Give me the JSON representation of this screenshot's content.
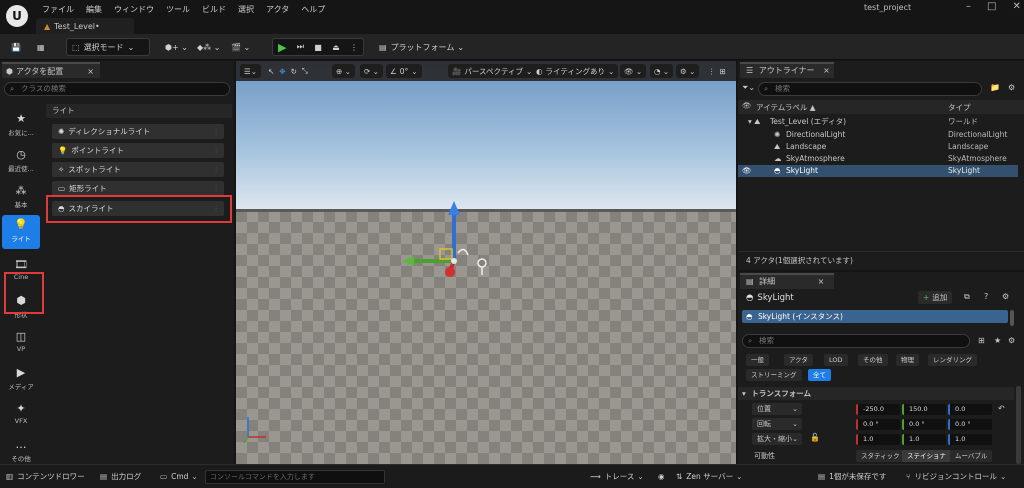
{
  "window": {
    "menu": [
      "ファイル",
      "編集",
      "ウィンドウ",
      "ツール",
      "ビルド",
      "選択",
      "アクタ",
      "ヘルプ"
    ],
    "level_tab": "Test_Level•",
    "project_name": "test_project"
  },
  "toolbar": {
    "select_mode": "選択モード",
    "platforms": "プラットフォーム"
  },
  "place_actors": {
    "tab_label": "アクタを配置",
    "search_placeholder": "クラスの検索",
    "section": "ライト",
    "categories": [
      "お気に...",
      "最近使...",
      "基本",
      "ライト",
      "Cine",
      "形状",
      "VP",
      "メディア",
      "VFX",
      "その他"
    ],
    "items": [
      "ディレクショナルライト",
      "ポイントライト",
      "スポットライト",
      "矩形ライト",
      "スカイライト"
    ]
  },
  "viewport": {
    "perspective": "パースペクティブ",
    "lighting": "ライティングあり",
    "snap_angle": "0°"
  },
  "outliner": {
    "tab_label": "アウトライナー",
    "search_placeholder": "検索",
    "col_label": "アイテムラベル ▲",
    "col_type": "タイプ",
    "rows": [
      {
        "name": "Test_Level (エディタ)",
        "type": "ワールド"
      },
      {
        "name": "DirectionalLight",
        "type": "DirectionalLight"
      },
      {
        "name": "Landscape",
        "type": "Landscape"
      },
      {
        "name": "SkyAtmosphere",
        "type": "SkyAtmosphere"
      },
      {
        "name": "SkyLight",
        "type": "SkyLight"
      }
    ],
    "footer": "4 アクタ(1個選択されています)"
  },
  "details": {
    "tab_label": "詳細",
    "actor_name": "SkyLight",
    "add_label": "追加",
    "component": "SkyLight (インスタンス)",
    "search_placeholder": "検索",
    "filters": [
      "一般",
      "アクタ",
      "LOD",
      "その他",
      "物理",
      "レンダリング",
      "ストリーミング",
      "全て"
    ],
    "section": "トランスフォーム",
    "location_label": "位置",
    "rotation_label": "回転",
    "scale_label": "拡大・縮小",
    "location": [
      "-250.0",
      "150.0",
      "0.0"
    ],
    "rotation": [
      "0.0 °",
      "0.0 °",
      "0.0 °"
    ],
    "scale": [
      "1.0",
      "1.0",
      "1.0"
    ],
    "mobility_label": "可動性",
    "mobility": [
      "スタティック",
      "ステイショナ",
      "ムーバブル"
    ]
  },
  "statusbar": {
    "content_drawer": "コンテンツドロワー",
    "output_log": "出力ログ",
    "cmd": "Cmd",
    "console_placeholder": "コンソールコマンドを入力します",
    "trace": "トレース",
    "zen": "Zen サーバー",
    "unsaved": "1個が未保存です",
    "revision": "リビジョンコントロール"
  },
  "colors": {
    "accent": "#1d7ee8",
    "highlight_outline": "#e03a3a",
    "selection": "#33506e"
  }
}
